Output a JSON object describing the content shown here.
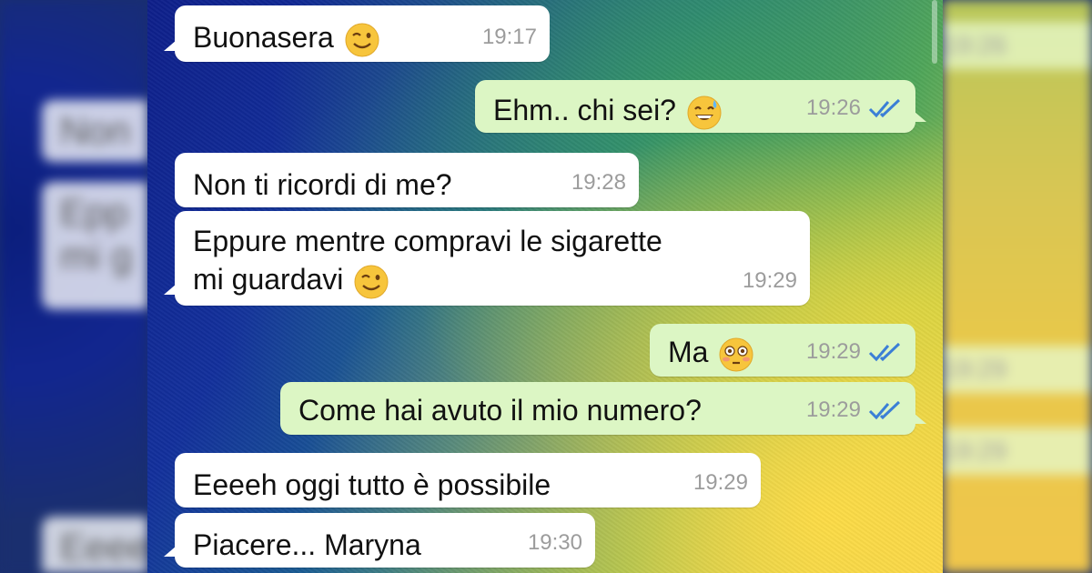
{
  "chat": {
    "messages": [
      {
        "id": "m1",
        "direction": "in",
        "text": "Buonasera",
        "emoji": "wink",
        "time": "19:17"
      },
      {
        "id": "m2",
        "direction": "out",
        "text": "Ehm.. chi sei?",
        "emoji": "sweat-smile",
        "time": "19:26",
        "read": true
      },
      {
        "id": "m3",
        "direction": "in",
        "text": "Non ti ricordi di me?",
        "time": "19:28"
      },
      {
        "id": "m4",
        "direction": "in",
        "text": "Eppure mentre compravi le sigarette\nmi guardavi",
        "emoji": "wink",
        "time": "19:29"
      },
      {
        "id": "m5",
        "direction": "out",
        "text": "Ma",
        "emoji": "flushed",
        "time": "19:29",
        "read": true
      },
      {
        "id": "m6",
        "direction": "out",
        "text": "Come hai avuto il mio numero?",
        "time": "19:29",
        "read": true
      },
      {
        "id": "m7",
        "direction": "in",
        "text": "Eeeeh oggi tutto è possibile",
        "time": "19:29"
      },
      {
        "id": "m8",
        "direction": "in",
        "text": "Piacere... Maryna",
        "time": "19:30"
      }
    ]
  },
  "background_side": {
    "left_ghosts": [
      "Non",
      "Epp",
      "mi g",
      "Eeee"
    ],
    "right_ghost_times": [
      "19:26",
      "19:29",
      "19:29"
    ]
  },
  "colors": {
    "incoming_bubble": "#ffffff",
    "outgoing_bubble": "#dcf6c4",
    "time_text": "#9c9c9c",
    "read_check": "#3b7fd6"
  }
}
